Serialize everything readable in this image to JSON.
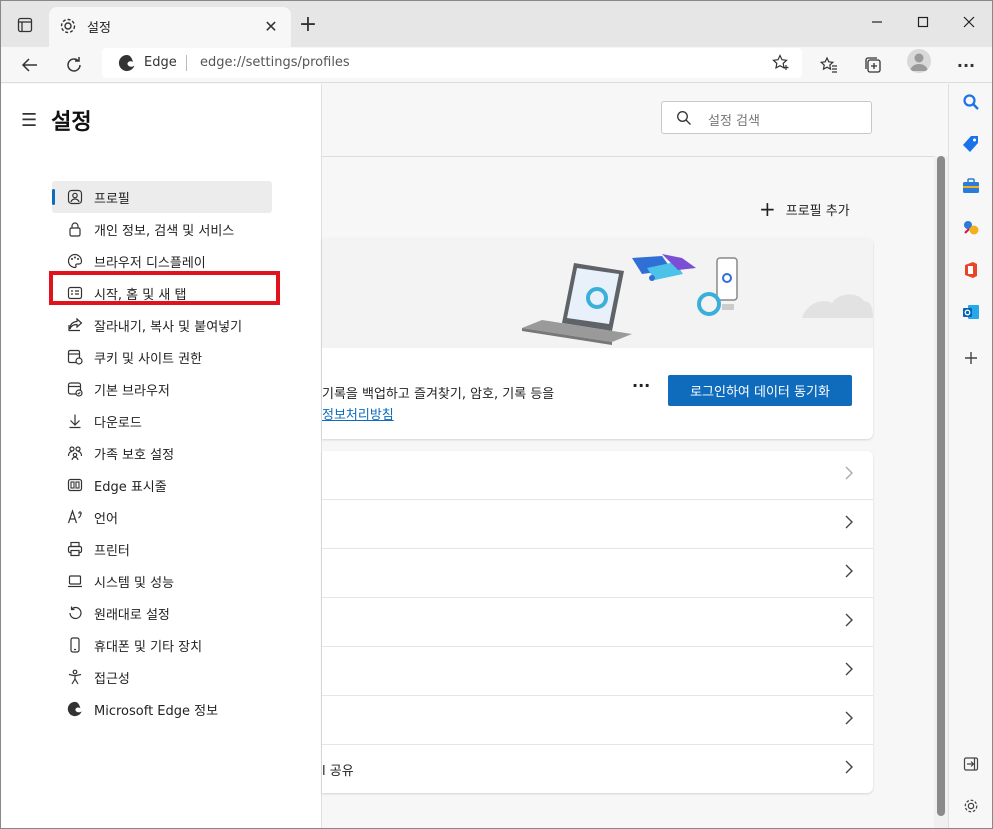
{
  "tab": {
    "title": "설정"
  },
  "address": {
    "site": "Edge",
    "url": "edge://settings/profiles"
  },
  "sidebar": {
    "title": "설정",
    "items": [
      {
        "label": "프로필",
        "icon": "profile-icon"
      },
      {
        "label": "개인 정보, 검색 및 서비스",
        "icon": "lock-icon"
      },
      {
        "label": "브라우저 디스플레이",
        "icon": "palette-icon"
      },
      {
        "label": "시작, 홈 및 새 탭",
        "icon": "home-tab-icon"
      },
      {
        "label": "잘라내기, 복사 및 붙여넣기",
        "icon": "share-icon"
      },
      {
        "label": "쿠키 및 사이트 권한",
        "icon": "cookie-icon"
      },
      {
        "label": "기본 브라우저",
        "icon": "browser-icon"
      },
      {
        "label": "다운로드",
        "icon": "download-icon"
      },
      {
        "label": "가족 보호 설정",
        "icon": "family-icon"
      },
      {
        "label": "Edge 표시줄",
        "icon": "edge-bar-icon"
      },
      {
        "label": "언어",
        "icon": "language-icon"
      },
      {
        "label": "프린터",
        "icon": "printer-icon"
      },
      {
        "label": "시스템 및 성능",
        "icon": "laptop-icon"
      },
      {
        "label": "원래대로 설정",
        "icon": "reset-icon"
      },
      {
        "label": "휴대폰 및 기타 장치",
        "icon": "phone-icon"
      },
      {
        "label": "접근성",
        "icon": "accessibility-icon"
      },
      {
        "label": "Microsoft Edge 정보",
        "icon": "edge-logo-icon"
      }
    ]
  },
  "search": {
    "placeholder": "설정 검색"
  },
  "main": {
    "add_profile": "프로필 추가",
    "card_desc": "기록을 백업하고 즐겨찾기, 암호, 기록 등을",
    "card_link": "정보처리방침",
    "more": "···",
    "signin": "로그인하여 데이터 동기화",
    "rows": [
      {
        "label": ""
      },
      {
        "label": ""
      },
      {
        "label": ""
      },
      {
        "label": ""
      },
      {
        "label": ""
      },
      {
        "label": ""
      },
      {
        "label": "l 공유"
      }
    ]
  },
  "colors": {
    "accent": "#0f6cbd",
    "highlight_box": "#e2121d"
  }
}
